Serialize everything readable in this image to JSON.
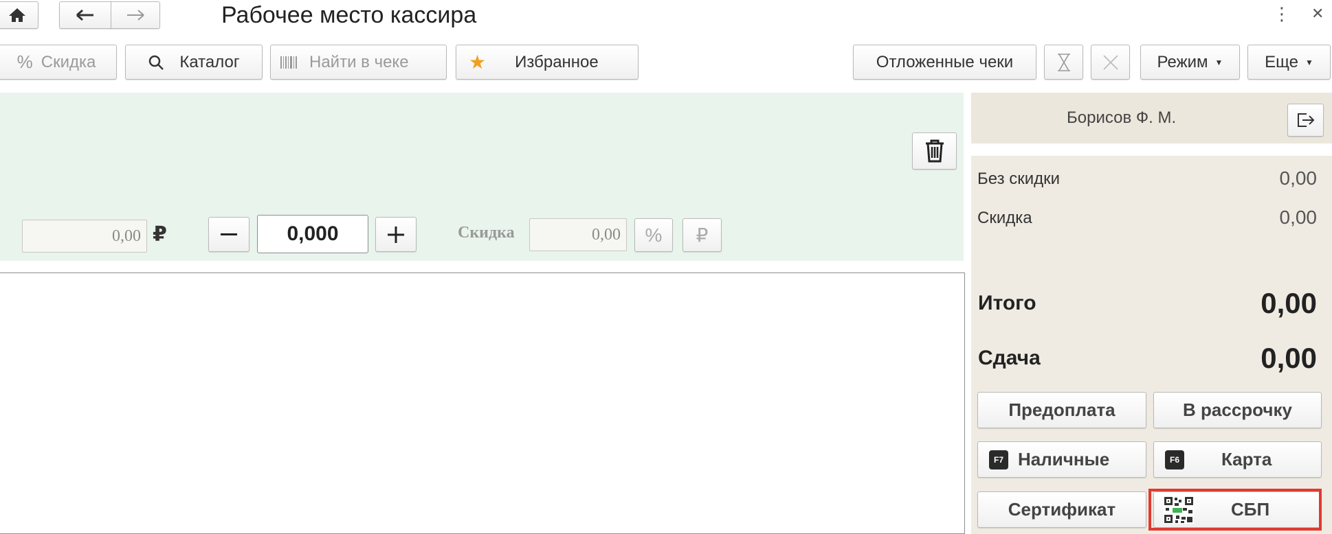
{
  "window": {
    "title": "Рабочее место кассира",
    "more_icon": "⋮",
    "close_icon": "✕"
  },
  "toolbar": {
    "discount_label": "Скидка",
    "catalog_label": "Каталог",
    "find_in_receipt_placeholder": "Найти в чеке",
    "favorites_label": "Избранное",
    "deferred_receipts_label": "Отложенные чеки",
    "mode_label": "Режим",
    "more_label": "Еще"
  },
  "entry": {
    "price_value": "0,00",
    "currency_symbol": "₽",
    "quantity_value": "0,000",
    "discount_label": "Скидка",
    "discount_value": "0,00",
    "percent_symbol": "%",
    "ruble_symbol": "₽"
  },
  "side": {
    "cashier_name": "Борисов Ф. М.",
    "without_discount_label": "Без скидки",
    "without_discount_value": "0,00",
    "discount_label": "Скидка",
    "discount_value": "0,00",
    "total_label": "Итого",
    "total_value": "0,00",
    "change_label": "Сдача",
    "change_value": "0,00"
  },
  "payment": {
    "prepayment_label": "Предоплата",
    "installment_label": "В рассрочку",
    "cash_key": "F7",
    "cash_label": "Наличные",
    "card_key": "F6",
    "card_label": "Карта",
    "certificate_label": "Сертификат",
    "sbp_label": "СБП"
  },
  "colors": {
    "entry_background": "#e9f4ec",
    "side_background": "#efebe2",
    "highlight": "#e03a30",
    "favorite_star": "#f0a020"
  }
}
